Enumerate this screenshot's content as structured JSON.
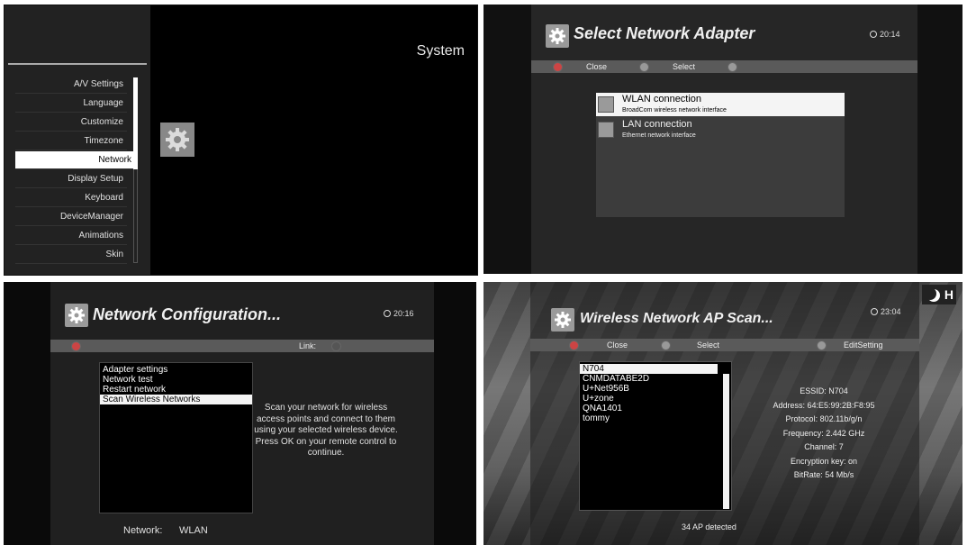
{
  "panel1": {
    "title": "System",
    "menu": [
      "A/V Settings",
      "Language",
      "Customize",
      "Timezone",
      "Network",
      "Display Setup",
      "Keyboard",
      "DeviceManager",
      "Animations",
      "Skin"
    ],
    "selected_index": 4,
    "icon": "gear-icon"
  },
  "panel2": {
    "title": "Select Network Adapter",
    "clock": "20:14",
    "buttons": {
      "close": "Close",
      "select": "Select"
    },
    "adapters": [
      {
        "name": "WLAN connection",
        "description": "BroadCom wireless network interface",
        "icon": "wlan-icon"
      },
      {
        "name": "LAN connection",
        "description": "Ethernet network interface",
        "icon": "lan-icon"
      }
    ]
  },
  "panel3": {
    "title": "Network Configuration...",
    "clock": "20:16",
    "link_label": "Link:",
    "menu": [
      "Adapter settings",
      "Network test",
      "Restart network",
      "Scan Wireless Networks"
    ],
    "selected_index": 3,
    "description": "Scan your network for wireless access points and connect to them using your selected wireless device.\nPress OK on your remote control to continue.",
    "status_label": "Network:",
    "status_value": "WLAN"
  },
  "panel4": {
    "title": "Wireless Network AP Scan...",
    "clock": "23:04",
    "buttons": {
      "close": "Close",
      "select": "Select",
      "edit": "EditSetting"
    },
    "networks": [
      "N704",
      "CNMDATABE2D",
      "U+Net956B",
      "U+zone",
      "QNA1401",
      "tommy"
    ],
    "selected_index": 0,
    "details": {
      "essid": "ESSID: N704",
      "address": "Address: 64:E5:99:2B:F8:95",
      "protocol": "Protocol: 802.11b/g/n",
      "frequency": "Frequency: 2.442 GHz",
      "channel": "Channel: 7",
      "encryption": "Encryption key: on",
      "bitrate": "BitRate: 54 Mb/s"
    },
    "status": "34 AP detected",
    "corner_logo": "H"
  }
}
